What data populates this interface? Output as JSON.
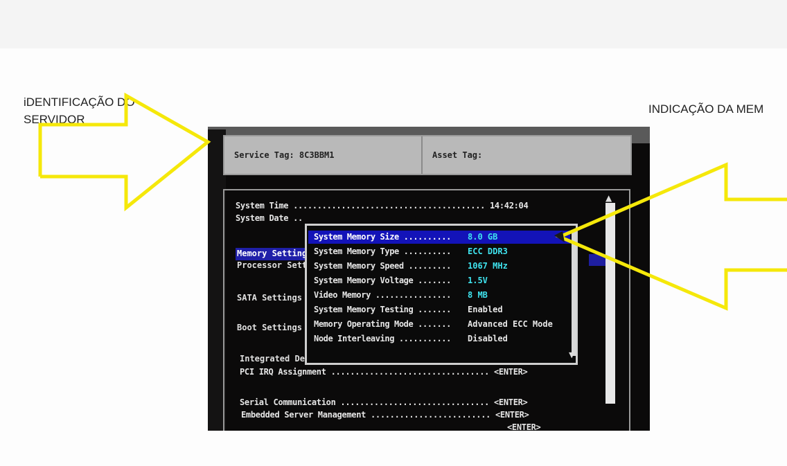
{
  "annotations": {
    "left_label_line1": "iDENTIFICAÇÃO DO",
    "left_label_line2": "SERVIDOR",
    "right_label": "INDICAÇÃO DA MEM"
  },
  "bios": {
    "service_tag": "Service Tag: 8C3BBM1",
    "asset_tag": "Asset Tag:",
    "system_time_row": "System Time ........................................ 14:42:04",
    "system_date_row": "System Date ..",
    "left_menu": [
      "Memory Setting",
      "Processor Sett",
      "SATA Settings",
      "Boot Settings",
      "Integrated Dev"
    ],
    "pci_irq_row": "PCI IRQ Assignment ................................. <ENTER>",
    "serial_comm_row": "Serial Communication ............................... <ENTER>",
    "embedded_mgmt_row": "Embedded Server Management ......................... <ENTER>",
    "embedded_mgmt_cut": "<ENTER>",
    "memory_popup": {
      "rows": [
        {
          "label": "System Memory Size ..........",
          "value": "8.0 GB"
        },
        {
          "label": "System Memory Type ..........",
          "value": "ECC DDR3"
        },
        {
          "label": "System Memory Speed .........",
          "value": "1067 MHz"
        },
        {
          "label": "System Memory Voltage .......",
          "value": "1.5V"
        },
        {
          "label": "Video Memory ................",
          "value": "8 MB"
        },
        {
          "label": "System Memory Testing .......",
          "value": "Enabled"
        },
        {
          "label": "Memory Operating Mode .......",
          "value": "Advanced ECC Mode"
        },
        {
          "label": "Node Interleaving ...........",
          "value": "Disabled"
        }
      ]
    }
  },
  "colors": {
    "arrow": "#f5e80a",
    "highlight": "#1313b8",
    "value_cyan": "#3fe3ee"
  }
}
